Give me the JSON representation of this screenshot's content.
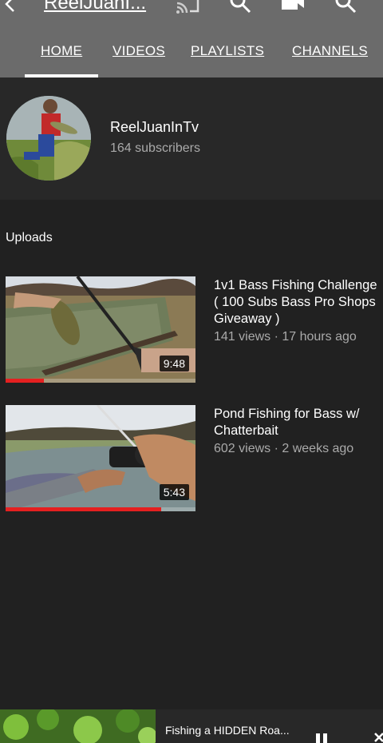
{
  "app_bar": {
    "title": "ReelJuanI...",
    "icons": [
      "back-arrow-icon",
      "cast-icon",
      "search-icon",
      "camera-icon",
      "search-icon"
    ]
  },
  "tabs": [
    {
      "label": "HOME",
      "selected": true
    },
    {
      "label": "VIDEOS",
      "selected": false
    },
    {
      "label": "PLAYLISTS",
      "selected": false
    },
    {
      "label": "CHANNELS",
      "selected": false
    }
  ],
  "channel": {
    "name": "ReelJuanInTv",
    "subscribers": "164 subscribers"
  },
  "uploads": {
    "title": "Uploads",
    "videos": [
      {
        "title": "1v1 Bass Fishing Challenge ( 100 Subs Bass Pro Shops Giveaway )",
        "meta": "141 views · 17 hours ago",
        "duration": "9:48",
        "watched_fraction": 0.2
      },
      {
        "title": "Pond Fishing for Bass w/ Chatterbait",
        "meta": "602 views · 2 weeks ago",
        "duration": "5:43",
        "watched_fraction": 0.82
      }
    ]
  },
  "mini_player": {
    "title": "Fishing a HIDDEN Roa..."
  },
  "colors": {
    "app_bar": "#6b6b6b",
    "background": "#212121",
    "header": "#282828",
    "progress": "#e52020",
    "secondary_text": "#aaaaaa"
  }
}
